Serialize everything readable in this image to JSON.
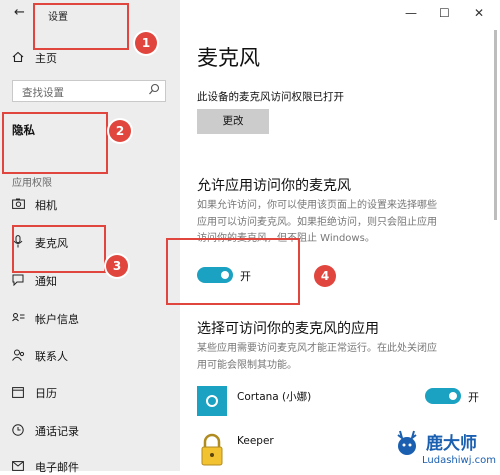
{
  "window": {
    "title": "设置",
    "back_icon": "back-arrow-icon",
    "minimize_glyph": "—",
    "maximize_glyph": "☐",
    "close_glyph": "✕"
  },
  "sidebar": {
    "home_label": "主页",
    "search_placeholder": "查找设置",
    "privacy_heading": "隐私",
    "section_label": "应用权限",
    "items": [
      {
        "label": "相机",
        "icon": "camera-icon"
      },
      {
        "label": "麦克风",
        "icon": "microphone-icon"
      },
      {
        "label": "通知",
        "icon": "notification-icon"
      },
      {
        "label": "帐户信息",
        "icon": "account-info-icon"
      },
      {
        "label": "联系人",
        "icon": "contacts-icon"
      },
      {
        "label": "日历",
        "icon": "calendar-icon"
      },
      {
        "label": "通话记录",
        "icon": "call-history-icon"
      },
      {
        "label": "电子邮件",
        "icon": "email-icon"
      }
    ]
  },
  "main": {
    "title": "麦克风",
    "status_text": "此设备的麦克风访问权限已打开",
    "change_button": "更改",
    "allow_heading": "允许应用访问你的麦克风",
    "allow_desc_lines": [
      "如果允许访问，你可以使用该页面上的设置来选择哪些",
      "应用可以访问麦克风。如果拒绝访问，则只会阻止应用",
      "访问你的麦克风，但不阻止 Windows。"
    ],
    "toggle_label": "开",
    "toggle_on": true,
    "choose_heading": "选择可访问你的麦克风的应用",
    "choose_desc_lines": [
      "某些应用需要访问麦克风才能正常运行。在此处关闭应",
      "用可能会限制其功能。"
    ],
    "apps": [
      {
        "name": "Cortana (小娜)",
        "toggle_label": "开",
        "toggle_on": true,
        "icon": "cortana-icon"
      },
      {
        "name": "Keeper",
        "icon": "keeper-lock-icon"
      }
    ]
  },
  "annotations": [
    "1",
    "2",
    "3",
    "4"
  ],
  "watermark": {
    "brand": "鹿大师",
    "url": "Ludashiwj.com"
  },
  "colors": {
    "accent": "#1ba2c2",
    "highlight": "#e0463d",
    "sidebar_bg": "#ededed"
  }
}
